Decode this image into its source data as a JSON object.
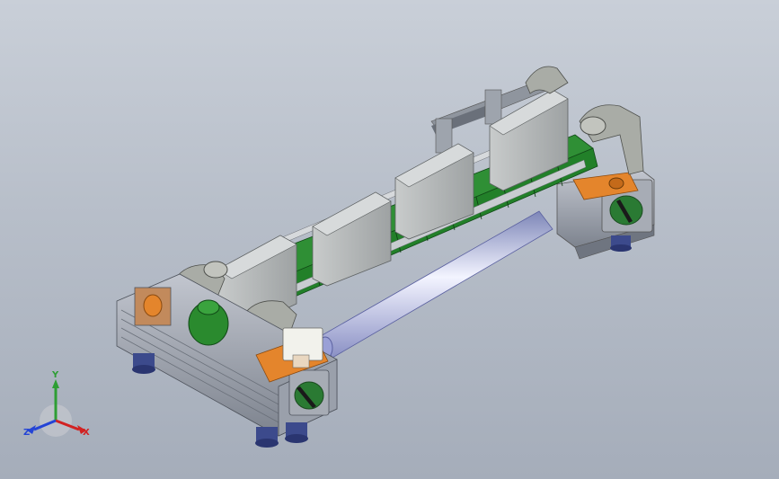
{
  "viewport": {
    "background": "#b7bec9"
  },
  "model": {
    "parts": [
      "base-frame",
      "conveyor-rail",
      "green-chain-links",
      "gray-covers",
      "roller",
      "clamps",
      "motor",
      "orange-brackets",
      "feet"
    ],
    "colors": {
      "frame": "#9aa0ab",
      "chain": "#1f8a2a",
      "cover": "#b9bdbf",
      "orange": "#e4852c",
      "roller": "#c8ccf5",
      "clamp": "#a9aca6",
      "foot": "#3c4a8c"
    }
  },
  "triad": {
    "axes": [
      {
        "label": "Y",
        "color": "#2e9e34",
        "icon": "y-axis-arrow"
      },
      {
        "label": "X",
        "color": "#d22222",
        "icon": "x-axis-arrow"
      },
      {
        "label": "Z",
        "color": "#2444d6",
        "icon": "z-axis-arrow"
      }
    ]
  }
}
